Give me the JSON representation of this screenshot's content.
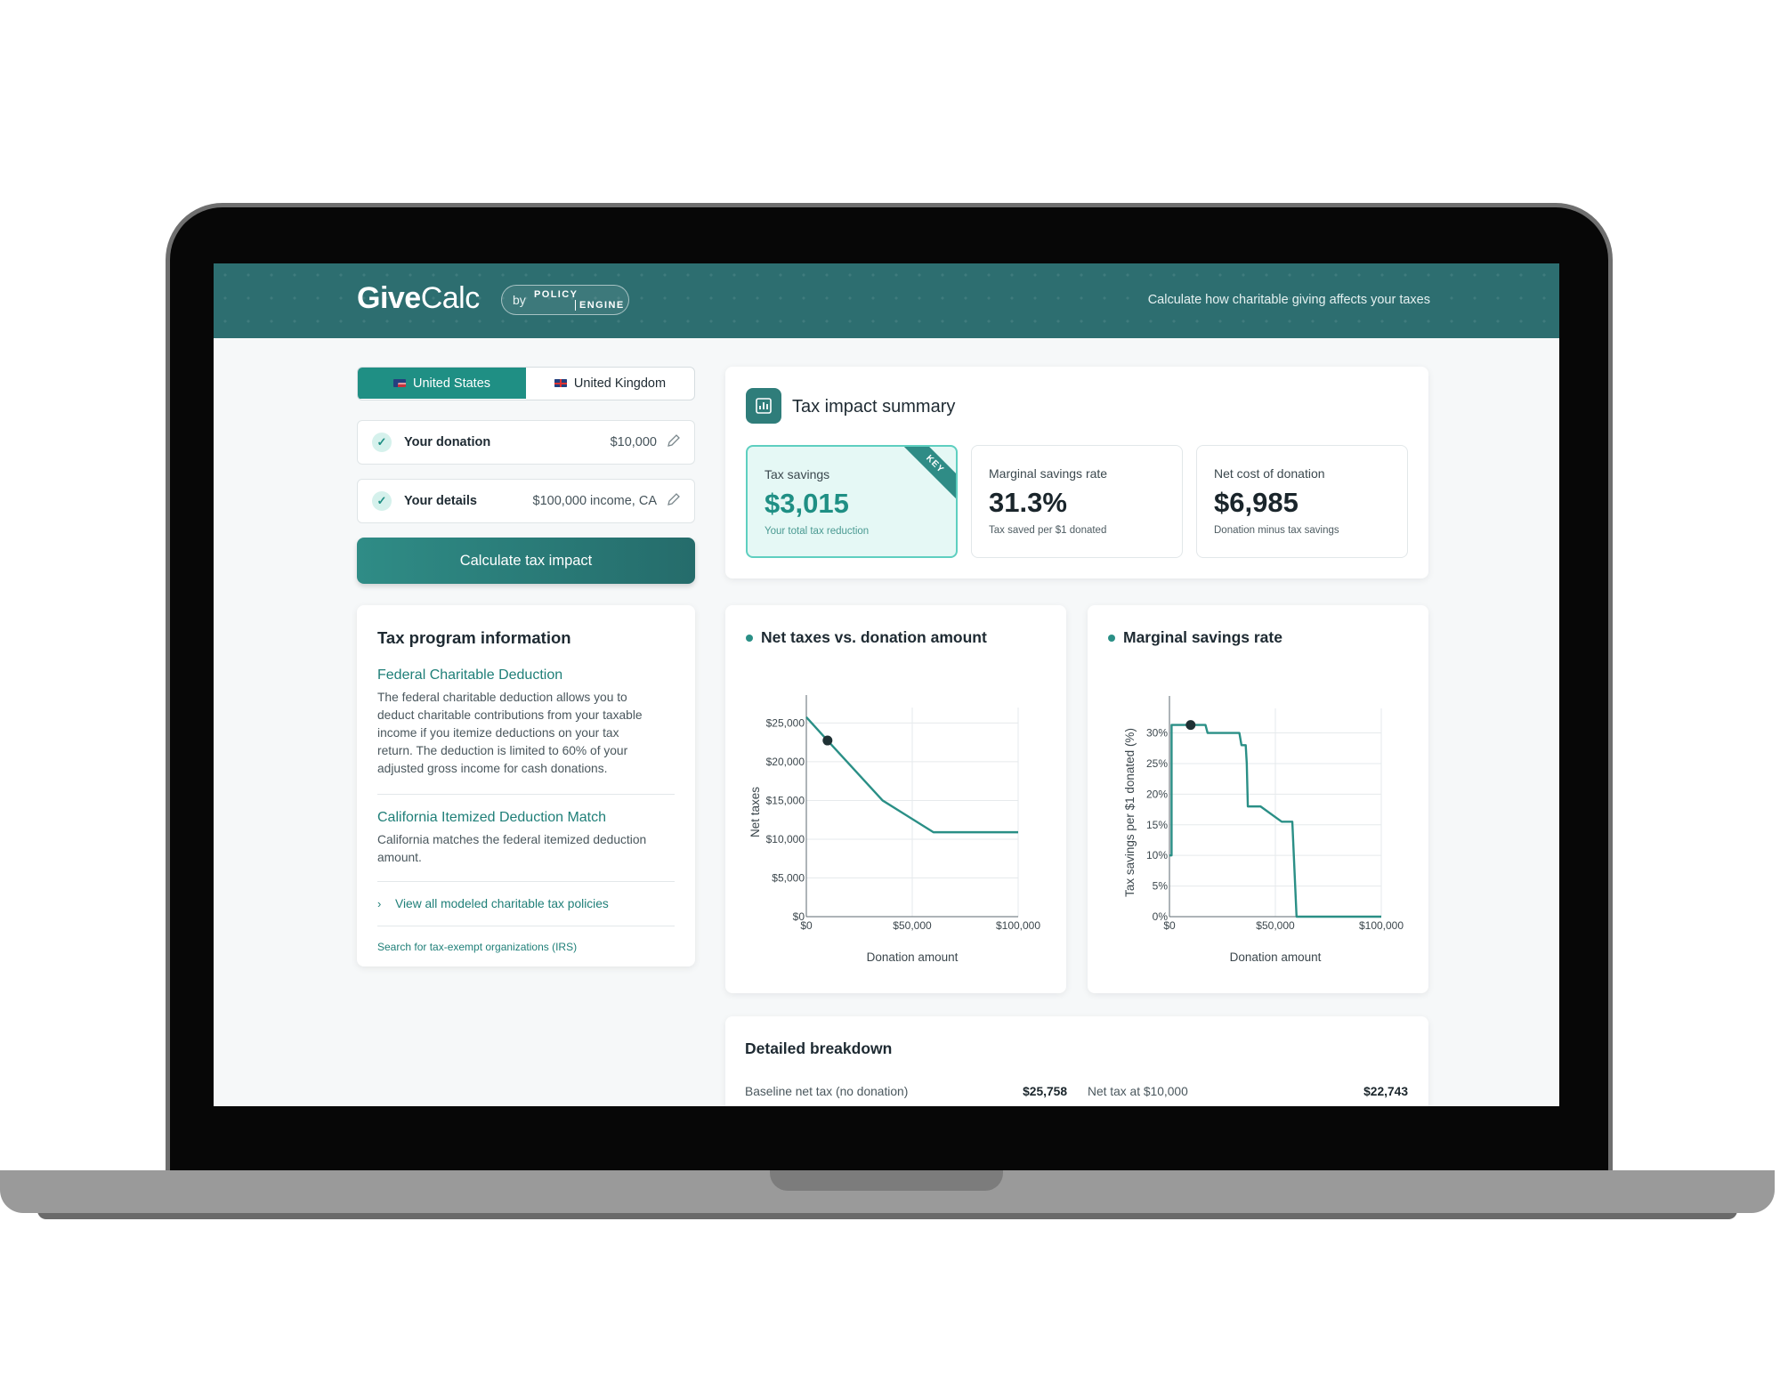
{
  "header": {
    "logo_give": "Give",
    "logo_calc": "Calc",
    "badge_by": "by",
    "badge_policy": "POLICY",
    "badge_engine": "ENGINE",
    "tagline": "Calculate how charitable giving affects your taxes"
  },
  "country_toggle": {
    "options": [
      {
        "label": "United States",
        "flag_icon": "us-flag-icon",
        "selected": true
      },
      {
        "label": "United Kingdom",
        "flag_icon": "uk-flag-icon",
        "selected": false
      }
    ]
  },
  "steps": {
    "donation": {
      "label": "Your donation",
      "value": "$10,000",
      "status_icon": "check-icon"
    },
    "details": {
      "label": "Your details",
      "value": "$100,000 income, CA",
      "status_icon": "check-icon"
    }
  },
  "calculate_button": "Calculate tax impact",
  "tax_program": {
    "title": "Tax program information",
    "policies": [
      {
        "title": "Federal Charitable Deduction",
        "lines": [
          "The federal charitable deduction allows you to",
          "deduct charitable contributions from your taxable",
          "income if you itemize deductions on your tax",
          "return. The deduction is limited to 60% of your",
          "adjusted gross income for cash donations."
        ]
      },
      {
        "title": "California Itemized Deduction Match",
        "lines": [
          "California matches the federal itemized deduction",
          "amount."
        ]
      }
    ],
    "view_all": "View all modeled charitable tax policies",
    "irs_link": "Search for tax-exempt organizations (IRS)"
  },
  "summary": {
    "title": "Tax impact summary",
    "icon": "bar-chart-icon",
    "metrics": [
      {
        "label": "Tax savings",
        "value": "$3,015",
        "sub": "Your total tax reduction",
        "badge": "KEY"
      },
      {
        "label": "Marginal savings rate",
        "value": "31.3%",
        "sub": "Tax saved per $1 donated"
      },
      {
        "label": "Net cost of donation",
        "value": "$6,985",
        "sub": "Donation minus tax savings"
      }
    ]
  },
  "chart_data": [
    {
      "type": "line",
      "title": "Net taxes vs. donation amount",
      "xlabel": "Donation amount",
      "ylabel": "Net taxes",
      "xlim": [
        0,
        100000
      ],
      "ylim": [
        0,
        27000
      ],
      "x_ticks": [
        "$0",
        "$50,000",
        "$100,000"
      ],
      "x_tick_values": [
        0,
        50000,
        100000
      ],
      "y_ticks": [
        "$0",
        "$5,000",
        "$10,000",
        "$15,000",
        "$20,000",
        "$25,000"
      ],
      "y_tick_values": [
        0,
        5000,
        10000,
        15000,
        20000,
        25000
      ],
      "grid": true,
      "series": [
        {
          "x": [
            0,
            10000,
            36000,
            60000,
            100000
          ],
          "y": [
            25758,
            22743,
            15000,
            10900,
            10900
          ]
        }
      ],
      "marker": {
        "x": 10000,
        "y": 22743
      },
      "color": "#2a8f86"
    },
    {
      "type": "line",
      "title": "Marginal savings rate",
      "xlabel": "Donation amount",
      "ylabel": "Tax savings per $1 donated (%)",
      "xlim": [
        0,
        100000
      ],
      "ylim": [
        0,
        34
      ],
      "x_ticks": [
        "$0",
        "$50,000",
        "$100,000"
      ],
      "x_tick_values": [
        0,
        50000,
        100000
      ],
      "y_ticks": [
        "0%",
        "5%",
        "10%",
        "15%",
        "20%",
        "25%",
        "30%"
      ],
      "y_tick_values": [
        0,
        5,
        10,
        15,
        20,
        25,
        30
      ],
      "grid": true,
      "series": [
        {
          "x": [
            0,
            1000,
            1000,
            17000,
            18000,
            25000,
            33000,
            34000,
            36000,
            36500,
            37000,
            42000,
            43000,
            53000,
            58000,
            60000,
            61000,
            100000
          ],
          "y": [
            10,
            10,
            31.3,
            31.3,
            30,
            30,
            30,
            28,
            28,
            25,
            18,
            18,
            18,
            15.5,
            15.5,
            0,
            0,
            0
          ]
        }
      ],
      "marker": {
        "x": 10000,
        "y": 31.3
      },
      "color": "#2a8f86"
    }
  ],
  "breakdown": {
    "title": "Detailed breakdown",
    "rows": [
      {
        "label": "Baseline net tax (no donation)",
        "value": "$25,758"
      },
      {
        "label": "Net tax at $10,000",
        "value": "$22,743"
      }
    ]
  }
}
